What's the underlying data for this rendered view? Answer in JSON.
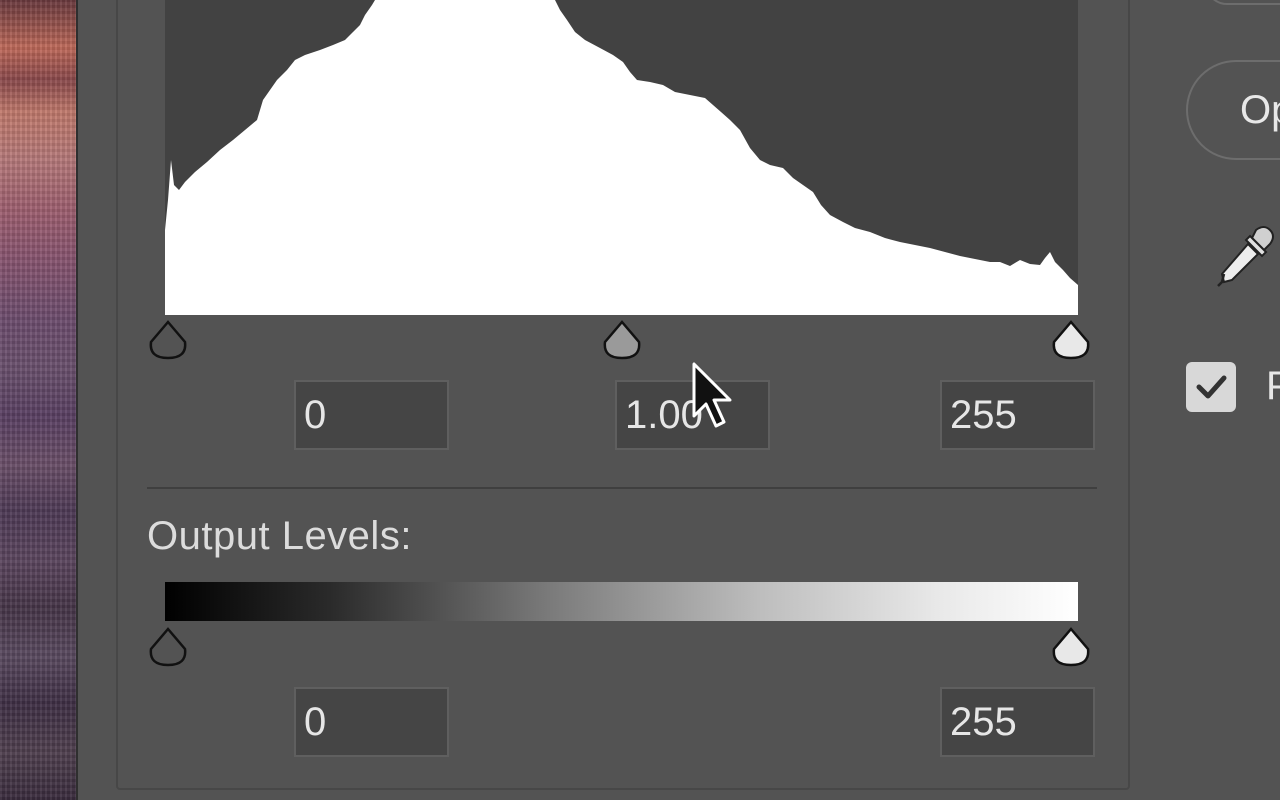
{
  "input_levels": {
    "shadows_value": "0",
    "midtones_value": "1.00",
    "highlights_value": "255"
  },
  "output_levels": {
    "label": "Output Levels:",
    "shadows_value": "0",
    "highlights_value": "255"
  },
  "side_panel": {
    "options_label": "Op",
    "checkbox_label": "P",
    "checkbox_checked": true
  },
  "icons": {
    "eyedropper": "eyedropper-icon",
    "checkmark": "checkmark-icon",
    "cursor": "mouse-pointer-icon"
  },
  "colors": {
    "panel_bg": "#535353",
    "field_bg": "#454545",
    "histogram_bg": "#424242",
    "histogram_fill": "#ffffff"
  }
}
